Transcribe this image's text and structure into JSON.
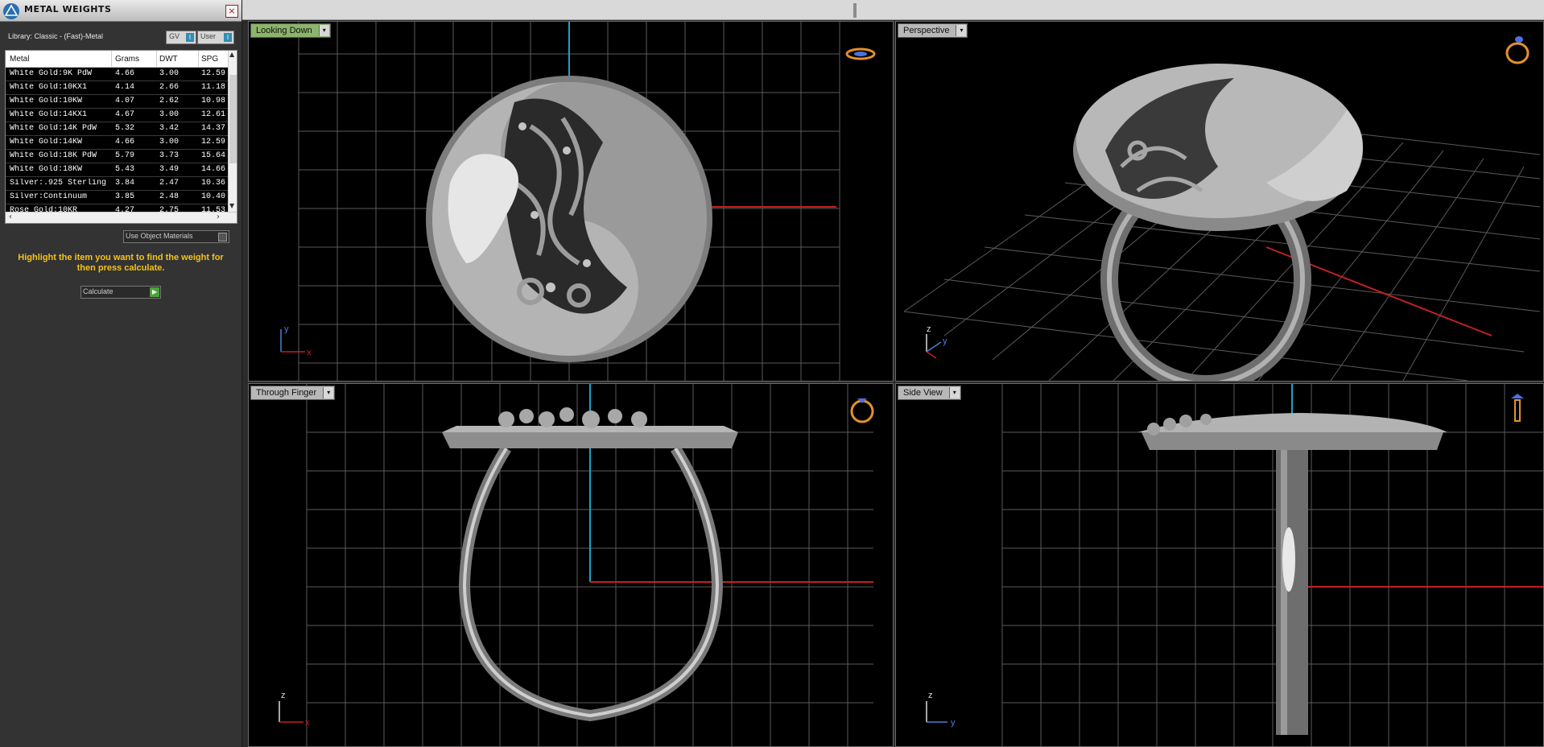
{
  "panel": {
    "title": "METAL WEIGHTS",
    "library_label": "Library: Classic - (Fast)-Metal",
    "toggle_gv": "GV",
    "toggle_user": "User",
    "toggle_button_glyph": "I",
    "columns": [
      "Metal",
      "Grams",
      "DWT",
      "SPG"
    ],
    "rows": [
      [
        "White Gold:9K PdW",
        "4.66",
        "3.00",
        "12.59"
      ],
      [
        "White Gold:10KX1",
        "4.14",
        "2.66",
        "11.18"
      ],
      [
        "White Gold:10KW",
        "4.07",
        "2.62",
        "10.98"
      ],
      [
        "White Gold:14KX1",
        "4.67",
        "3.00",
        "12.61"
      ],
      [
        "White Gold:14K PdW",
        "5.32",
        "3.42",
        "14.37"
      ],
      [
        "White Gold:14KW",
        "4.66",
        "3.00",
        "12.59"
      ],
      [
        "White Gold:18K PdW",
        "5.79",
        "3.73",
        "15.64"
      ],
      [
        "White Gold:18KW",
        "5.43",
        "3.49",
        "14.66"
      ],
      [
        "Silver:.925 Sterling",
        "3.84",
        "2.47",
        "10.36"
      ],
      [
        "Silver:Continuum",
        "3.85",
        "2.48",
        "10.40"
      ],
      [
        "Rose Gold:10KR",
        "4.27",
        "2.75",
        "11.53"
      ]
    ],
    "use_object_materials": "Use Object Materials",
    "hint": "Highlight the item you want to find the weight for then press calculate.",
    "calculate": "Calculate",
    "close_glyph": "×"
  },
  "viewports": {
    "top": {
      "label": "Looking Down",
      "axis1": "y",
      "axis2": "x"
    },
    "perspective": {
      "label": "Perspective",
      "axis1": "z",
      "axis2": "y"
    },
    "front": {
      "label": "Through Finger",
      "axis1": "z",
      "axis2": "x"
    },
    "side": {
      "label": "Side View",
      "axis1": "z",
      "axis2": "y"
    },
    "dropdown_glyph": "▾"
  },
  "colors": {
    "grid": "#5a5a5a",
    "axis_red": "#c22121",
    "axis_cyan": "#1aa4c4",
    "hint": "#f4c21b",
    "metal": "#a8a8a8"
  },
  "icons": [
    "app-logo-icon",
    "close-icon",
    "ring-icon",
    "scroll-arrow-icon"
  ]
}
